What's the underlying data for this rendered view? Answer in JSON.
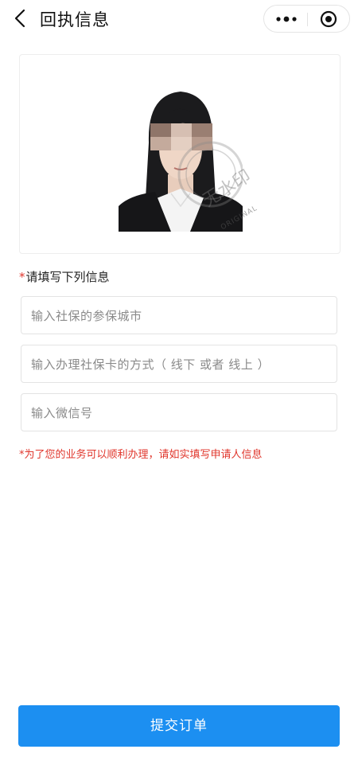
{
  "header": {
    "title": "回执信息",
    "icons": {
      "back": "chevron-left-icon",
      "more": "more-dots-icon",
      "close": "target-circle-icon"
    }
  },
  "photo": {
    "watermark_text": "无水印",
    "stamp_text": "ORIGINAL"
  },
  "form": {
    "section_label": "请填写下列信息",
    "required_mark": "*",
    "fields": [
      {
        "placeholder": "输入社保的参保城市",
        "value": ""
      },
      {
        "placeholder": "输入办理社保卡的方式（ 线下 或者 线上 ）",
        "value": ""
      },
      {
        "placeholder": "输入微信号",
        "value": ""
      }
    ],
    "note": "*为了您的业务可以顺利办理，请如实填写申请人信息"
  },
  "submit": {
    "label": "提交订单"
  },
  "colors": {
    "accent": "#1c8ff1",
    "required": "#e0362c"
  }
}
